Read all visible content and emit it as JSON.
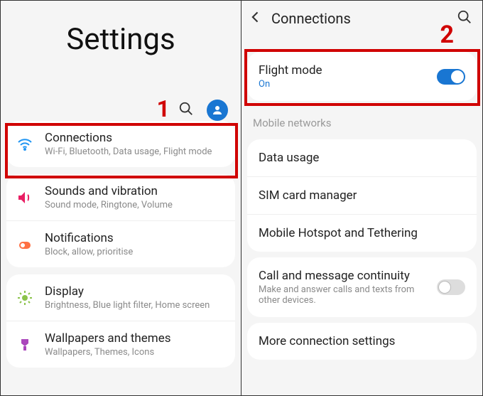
{
  "left": {
    "title": "Settings",
    "annotation": "1",
    "items": [
      {
        "icon": "wifi",
        "title": "Connections",
        "sub": "Wi-Fi, Bluetooth, Data usage, Flight mode"
      },
      {
        "icon": "sound",
        "title": "Sounds and vibration",
        "sub": "Sound mode, Ringtone, Volume"
      },
      {
        "icon": "notif",
        "title": "Notifications",
        "sub": "Block, allow, prioritise"
      },
      {
        "icon": "display",
        "title": "Display",
        "sub": "Brightness, Blue light filter, Home screen"
      },
      {
        "icon": "wallpaper",
        "title": "Wallpapers and themes",
        "sub": "Wallpapers, Themes, Icons"
      }
    ]
  },
  "right": {
    "title": "Connections",
    "annotation": "2",
    "flight_mode": {
      "title": "Flight mode",
      "status": "On",
      "toggle": true
    },
    "section_label": "Mobile networks",
    "items": [
      {
        "title": "Data usage"
      },
      {
        "title": "SIM card manager"
      },
      {
        "title": "Mobile Hotspot and Tethering"
      }
    ],
    "continuity": {
      "title": "Call and message continuity",
      "sub": "Make and answer calls and texts from other devices.",
      "toggle": false
    },
    "more": {
      "title": "More connection settings"
    }
  },
  "colors": {
    "highlight": "#d00000",
    "accent": "#1976d2"
  }
}
